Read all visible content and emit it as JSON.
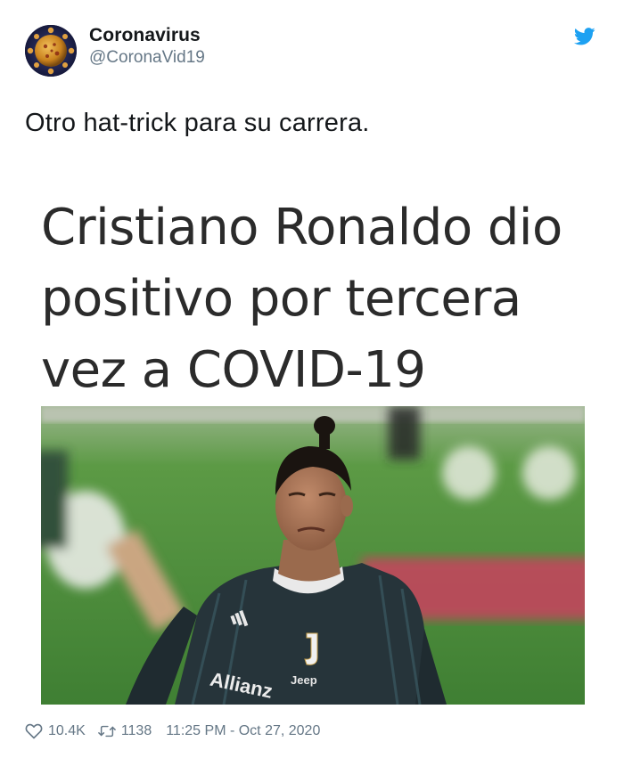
{
  "author": {
    "display_name": "Coronavirus",
    "handle": "@CoronaVid19",
    "avatar_icon": "coronavirus-avatar",
    "logo_icon": "twitter-bird-icon"
  },
  "tweet": {
    "text": "Otro hat-trick para su carrera."
  },
  "media": {
    "headline_lines": [
      "Cristiano Ronaldo dio",
      "positivo por tercera",
      "vez a COVID-19"
    ]
  },
  "footer": {
    "likes": "10.4K",
    "retweets": "1138",
    "timestamp": "11:25 PM - Oct 27, 2020"
  },
  "colors": {
    "brand_blue": "#1DA1F2",
    "muted_text": "#657786",
    "text": "#14171a"
  }
}
